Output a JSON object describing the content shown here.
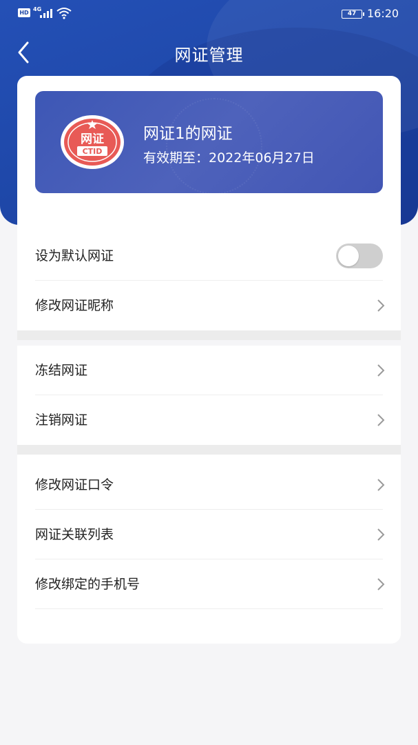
{
  "status_bar": {
    "hd": "HD",
    "network": "4G",
    "battery": "47",
    "time": "16:20"
  },
  "nav": {
    "title": "网证管理"
  },
  "certificate": {
    "name": "网证1的网证",
    "expiry": "有效期至：2022年06月27日",
    "seal_text": "网证",
    "seal_sub": "CTID"
  },
  "settings": {
    "default_label": "设为默认网证",
    "default_enabled": false,
    "rename_label": "修改网证昵称"
  },
  "actions": {
    "freeze_label": "冻结网证",
    "cancel_label": "注销网证"
  },
  "security": {
    "password_label": "修改网证口令",
    "association_label": "网证关联列表",
    "phone_label": "修改绑定的手机号"
  },
  "colors": {
    "header": "#1e47a8",
    "card": "#4a5fb9",
    "seal": "#e85a56"
  }
}
